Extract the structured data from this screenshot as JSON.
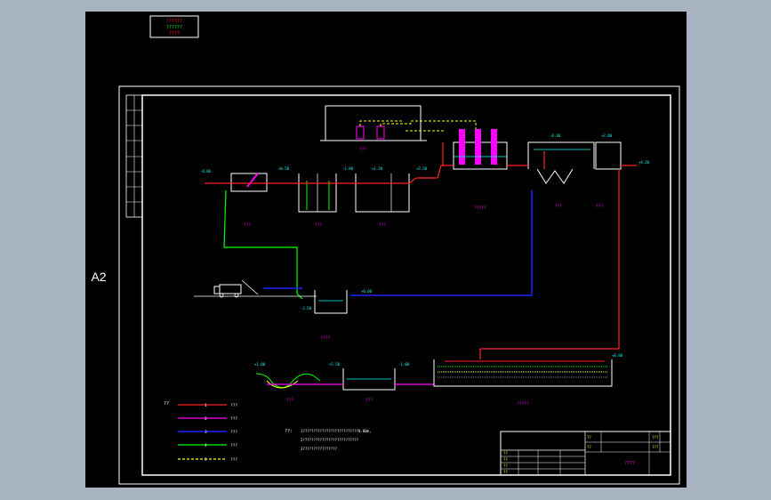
{
  "app": {
    "title_stamp_lines": [
      "??????",
      "??????",
      "????"
    ]
  },
  "sheet": {
    "size_label": "A2",
    "drawing_title": "????",
    "title_block": {
      "cells": [
        "??",
        "??",
        "??",
        "??",
        "??",
        "??",
        "???",
        "???"
      ]
    }
  },
  "process_labels": {
    "water_intake": "???",
    "sludge_pit": "???",
    "filter_building": "?????",
    "settling_tank": "???",
    "thickener": "???",
    "dosing_room": "???",
    "clear_well": "????",
    "pump_station": "????",
    "wetland": "???",
    "sludge_dewatering": "?????",
    "grit_chamber": "???",
    "storage_tank": "???"
  },
  "elevations": [
    "-0.06",
    "+0.50",
    "-1.80",
    "+1.20",
    "+3.50",
    "-0.30",
    "+2.80",
    "+4.20",
    "+0.00",
    "-2.50",
    "+1.00",
    "+5.50",
    "-1.00",
    "+0.80"
  ],
  "legend": {
    "title": "??",
    "items": [
      {
        "num": "1",
        "label": "???",
        "color": "#ff2020"
      },
      {
        "num": "2",
        "label": "???",
        "color": "#ff00ff"
      },
      {
        "num": "3",
        "label": "???",
        "color": "#2020ff"
      },
      {
        "num": "4",
        "label": "???",
        "color": "#00ff00"
      },
      {
        "num": "5",
        "label": "???",
        "color": "#ffff00"
      }
    ]
  },
  "notes": {
    "title": "??:",
    "lines": [
      "1??????????????????????????0.00m,",
      "2??????????????????????????",
      "3????????????????"
    ]
  },
  "colors": {
    "frame": "#ffffff",
    "water": "#ff2020",
    "sludge": "#ff00ff",
    "return": "#2020ff",
    "overflow": "#00ff00",
    "air": "#ffff00",
    "cyan": "#00ffff"
  }
}
